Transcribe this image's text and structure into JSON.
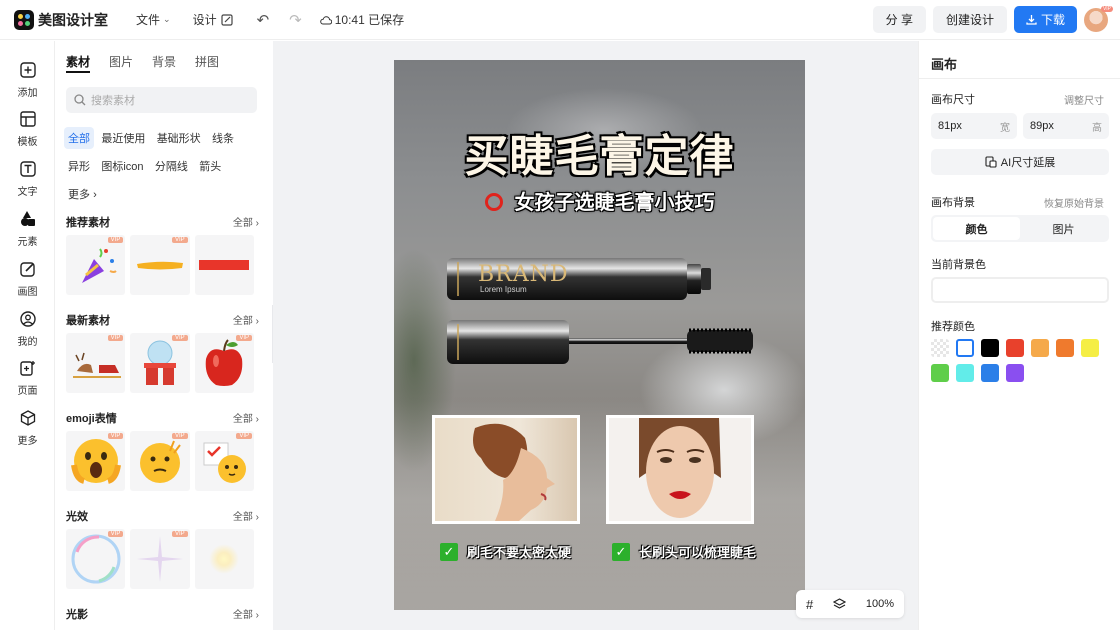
{
  "app": {
    "title": "美图设计室"
  },
  "topbar": {
    "file_label": "文件",
    "design_label": "设计",
    "save_status": "10:41 已保存",
    "share_label": "分 享",
    "create_label": "创建设计",
    "download_label": "下载",
    "avatar_badge": "VIP"
  },
  "rail": [
    {
      "label": "添加",
      "icon": "plus-square-icon"
    },
    {
      "label": "模板",
      "icon": "template-icon"
    },
    {
      "label": "文字",
      "icon": "text-icon"
    },
    {
      "label": "元素",
      "icon": "shapes-icon"
    },
    {
      "label": "画图",
      "icon": "edit-icon"
    },
    {
      "label": "我的",
      "icon": "user-icon"
    },
    {
      "label": "页面",
      "icon": "add-page-icon"
    },
    {
      "label": "更多",
      "icon": "cube-icon"
    }
  ],
  "panel": {
    "tabs": [
      "素材",
      "图片",
      "背景",
      "拼图"
    ],
    "search_placeholder": "搜索素材",
    "chips": [
      "全部",
      "最近使用",
      "基础形状",
      "线条",
      "异形",
      "图标icon",
      "分隔线",
      "箭头",
      "更多"
    ],
    "sections": [
      {
        "title": "推荐素材",
        "all": "全部"
      },
      {
        "title": "最新素材",
        "all": "全部"
      },
      {
        "title": "emoji表情",
        "all": "全部"
      },
      {
        "title": "光效",
        "all": "全部"
      },
      {
        "title": "光影",
        "all": "全部"
      }
    ],
    "vip": "VIP"
  },
  "poster": {
    "title": "买睫毛膏定律",
    "subtitle": "女孩子选睫毛膏小技巧",
    "brand": "BRAND",
    "brand_sub": "Lorem Ipsum",
    "tip1": "刷毛不要太密太硬",
    "tip2": "长刷头可以梳理睫毛"
  },
  "zoom": {
    "value": "100%"
  },
  "props": {
    "header": "画布",
    "size_label": "画布尺寸",
    "size_link": "调整尺寸",
    "width_value": "81px",
    "width_unit": "宽",
    "height_value": "89px",
    "height_unit": "高",
    "ai_label": "AI尺寸延展",
    "bg_label": "画布背景",
    "bg_link": "恢复原始背景",
    "seg_color": "颜色",
    "seg_image": "图片",
    "current_bg_label": "当前背景色",
    "recommend_label": "推荐颜色",
    "swatches": [
      "transparent",
      "#ffffff",
      "#000000",
      "#e8412c",
      "#f5a94a",
      "#ef7a2d",
      "#f5ee45",
      "#5fce4a",
      "#62ece9",
      "#2b7fe8",
      "#8a4ff0"
    ]
  }
}
